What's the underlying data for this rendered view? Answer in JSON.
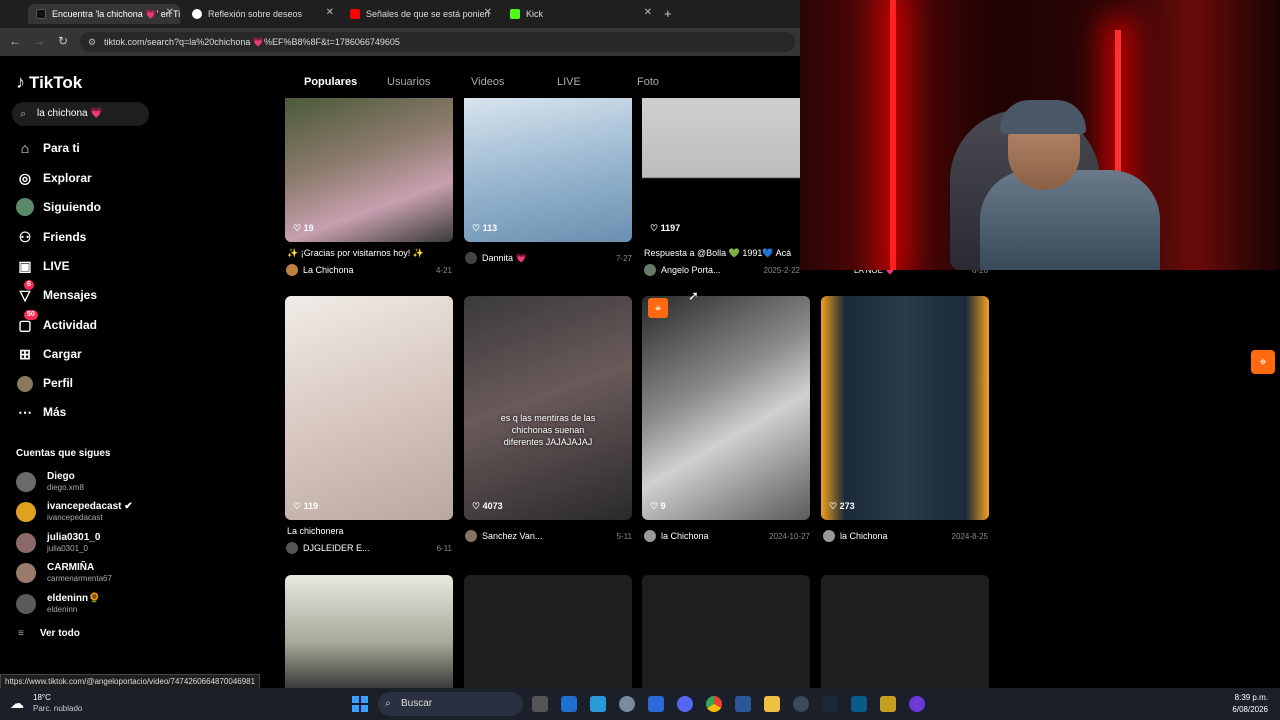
{
  "browser": {
    "tabs": [
      {
        "title": "Encuentra 'la chichona 💗' en Ti",
        "active": true
      },
      {
        "title": "Reflexión sobre deseos",
        "active": false
      },
      {
        "title": "Señales de que se está ponien",
        "active": false
      },
      {
        "title": "Kick",
        "active": false
      }
    ],
    "new_tab": "+",
    "url": "tiktok.com/search?q=la%20chichona 💗%EF%B8%8F&t=1786066749605",
    "status_url": "https://www.tiktok.com/@angeloportacio/video/7474260664870046981"
  },
  "tiktok": {
    "logo": "TikTok",
    "search_value": "la chichona 💗",
    "nav": [
      {
        "label": "Para ti",
        "icon": "home-icon",
        "badge": ""
      },
      {
        "label": "Explorar",
        "icon": "compass-icon",
        "badge": ""
      },
      {
        "label": "Siguiendo",
        "icon": "following-icon",
        "badge": ""
      },
      {
        "label": "Friends",
        "icon": "friends-icon",
        "badge": ""
      },
      {
        "label": "LIVE",
        "icon": "live-icon",
        "badge": ""
      },
      {
        "label": "Mensajes",
        "icon": "messages-icon",
        "badge": "6"
      },
      {
        "label": "Actividad",
        "icon": "activity-icon",
        "badge": "50"
      },
      {
        "label": "Cargar",
        "icon": "upload-icon",
        "badge": ""
      },
      {
        "label": "Perfil",
        "icon": "profile-icon",
        "badge": ""
      },
      {
        "label": "Más",
        "icon": "more-icon",
        "badge": ""
      }
    ],
    "following_title": "Cuentas que sigues",
    "following": [
      {
        "name": "Diego",
        "user": "diego.xm8"
      },
      {
        "name": "ivancepedacast ✔",
        "user": "ivancepedacast"
      },
      {
        "name": "julia0301_0",
        "user": "julia0301_0"
      },
      {
        "name": "CARMIÑA",
        "user": "carmenarmenta67"
      },
      {
        "name": "eldeninn🌻",
        "user": "eldeninn"
      }
    ],
    "see_all": "Ver todo",
    "tabs": [
      "Populares",
      "Usuarios",
      "Videos",
      "LIVE",
      "Foto"
    ],
    "row1": [
      {
        "likes": "♡ 19",
        "caption": "✨ ¡Gracias por visitarnos hoy! ✨",
        "author": "La Chichona",
        "date": "4-21"
      },
      {
        "likes": "♡ 113",
        "caption": "",
        "author": "Dannita 💗",
        "date": "7-27"
      },
      {
        "likes": "♡ 1197",
        "caption": "Respuesta a @Bolla 💚 1991💙 Acá",
        "author": "Angelo Porta...",
        "date": "2025-2-22"
      }
    ],
    "row2": [
      {
        "likes": "♡ 119",
        "caption": "La chichonera",
        "author": "DJGLEIDER E...",
        "date": "6-11"
      },
      {
        "likes": "♡ 4073",
        "caption": "",
        "author": "Sanchez Van...",
        "date": "5-11",
        "overlay": "es q las mentiras de las chichonas suenan diferentes JAJAJAJAJ"
      },
      {
        "likes": "♡ 9",
        "caption": "",
        "author": "la Chichona",
        "date": "2024-10-27"
      },
      {
        "likes": "♡ 273",
        "caption": "",
        "author": "la Chichona",
        "date": "2024-8-25"
      }
    ],
    "partial_caption": "LA NOE 💗",
    "partial_date": "6-26"
  },
  "taskbar": {
    "weather_temp": "18°C",
    "weather_desc": "Parc. nublado",
    "search": "Buscar",
    "time": "8:39 p.m.",
    "date": "6/08/2026"
  },
  "colors": {
    "accent": "#fe2c55",
    "bg": "#000000",
    "sidebar_text": "#ffffff"
  }
}
